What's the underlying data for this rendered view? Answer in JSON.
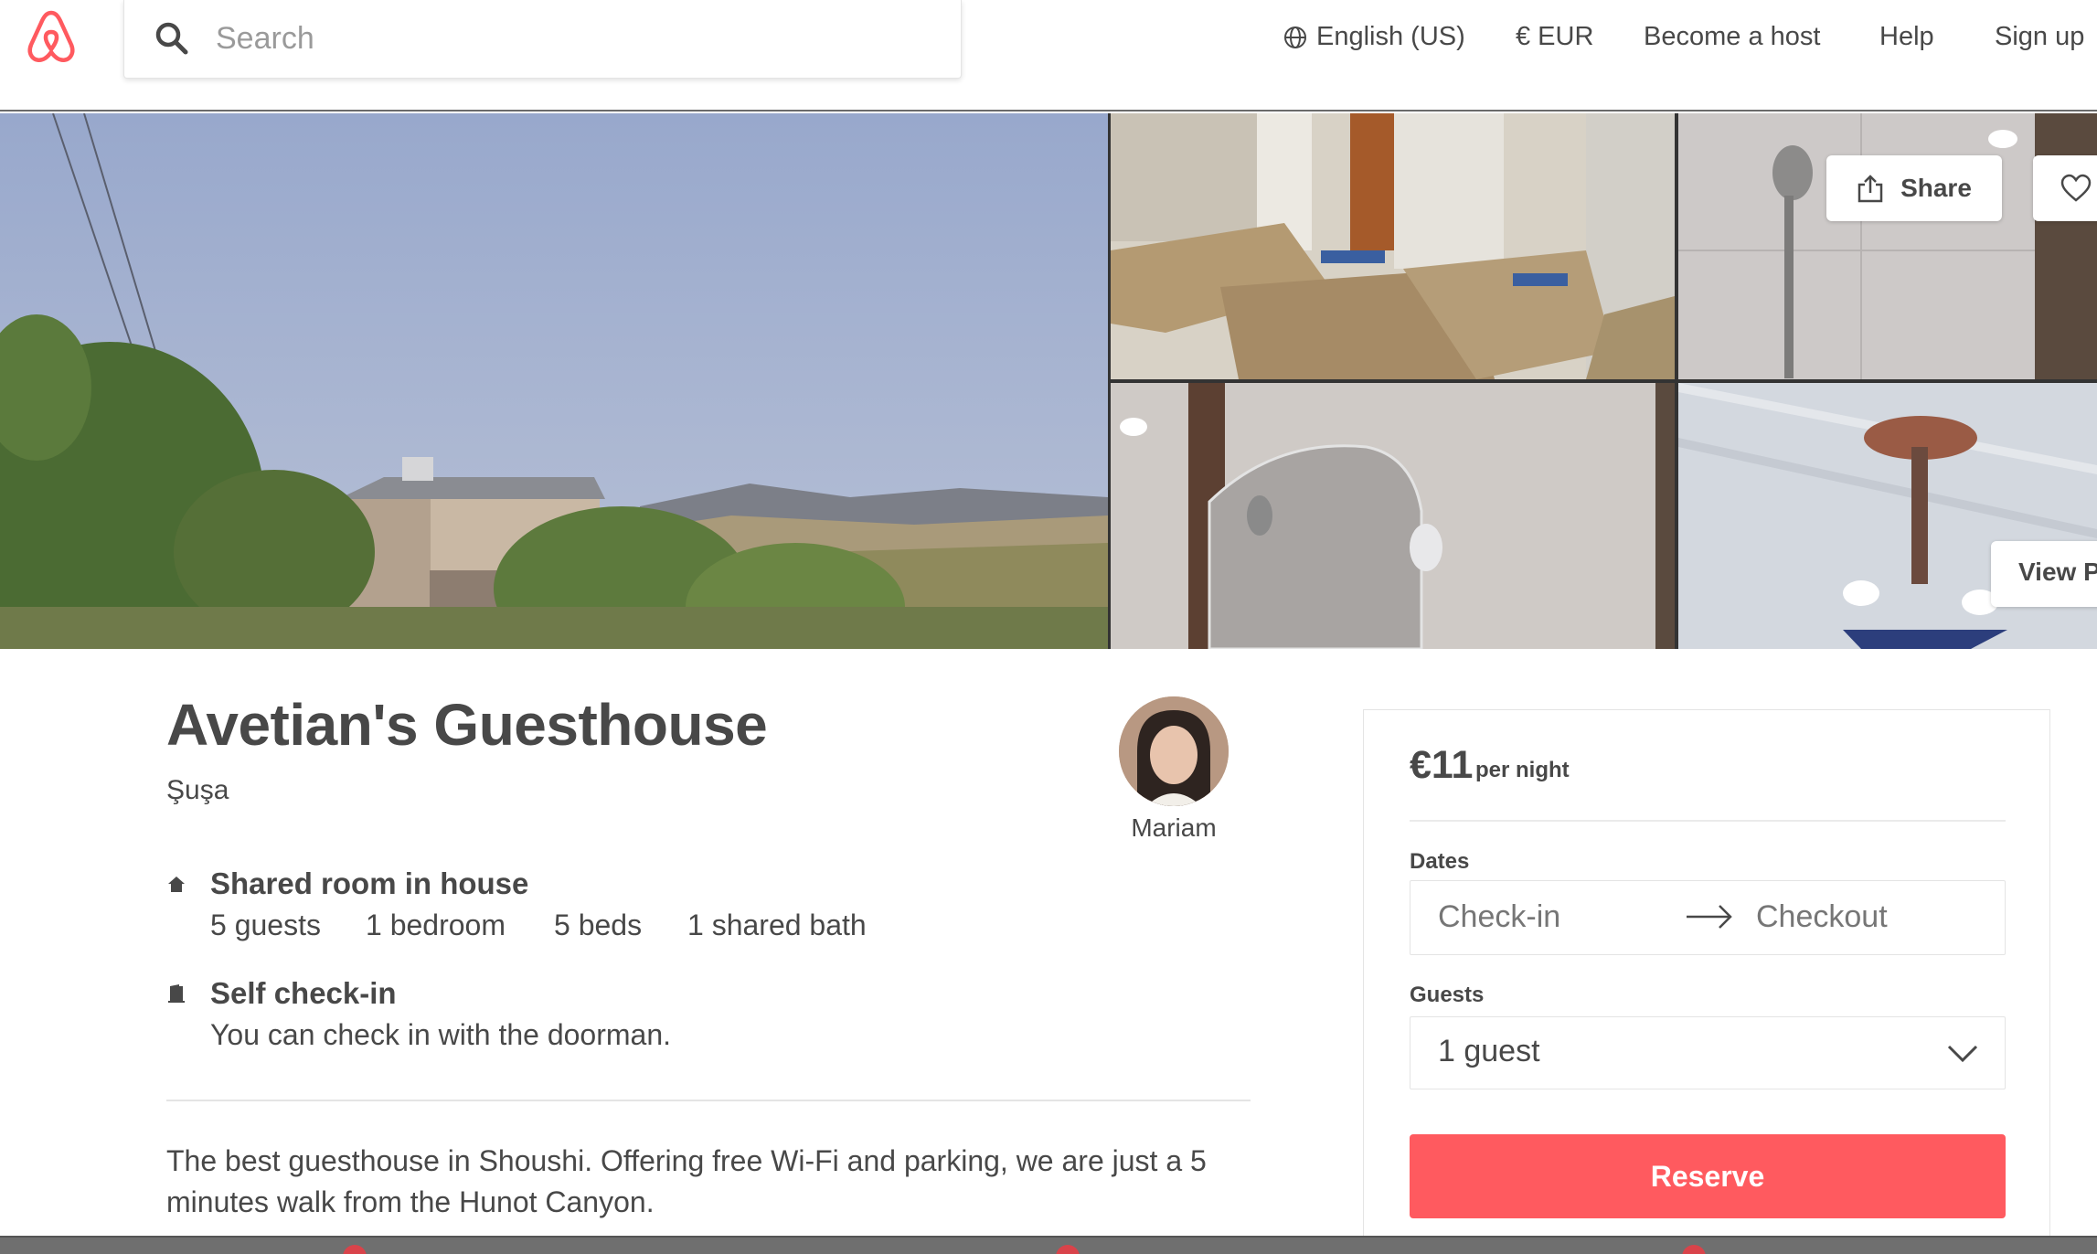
{
  "header": {
    "search_placeholder": "Search",
    "language": "English (US)",
    "currency": "€ EUR",
    "become_host": "Become a host",
    "help": "Help",
    "sign_up": "Sign up"
  },
  "photos": {
    "share_label": "Share",
    "view_photos_label": "View P"
  },
  "listing": {
    "title": "Avetian's Guesthouse",
    "location": "Şuşa",
    "host_name": "Mariam",
    "room_type": "Shared room in house",
    "guests": "5 guests",
    "bedrooms": "1 bedroom",
    "beds": "5 beds",
    "baths": "1 shared bath",
    "checkin_title": "Self check-in",
    "checkin_desc": "You can check in with the doorman.",
    "description": "The best guesthouse in Shoushi. Offering free Wi-Fi and parking, we are just a 5 minutes walk from the Hunot Canyon."
  },
  "booking": {
    "price": "€11",
    "per_night": "per night",
    "dates_label": "Dates",
    "checkin_placeholder": "Check-in",
    "checkout_placeholder": "Checkout",
    "guests_label": "Guests",
    "guests_value": "1 guest",
    "reserve_label": "Reserve"
  },
  "colors": {
    "brand": "#ff5a5f",
    "text": "#484848",
    "muted": "#767676"
  }
}
